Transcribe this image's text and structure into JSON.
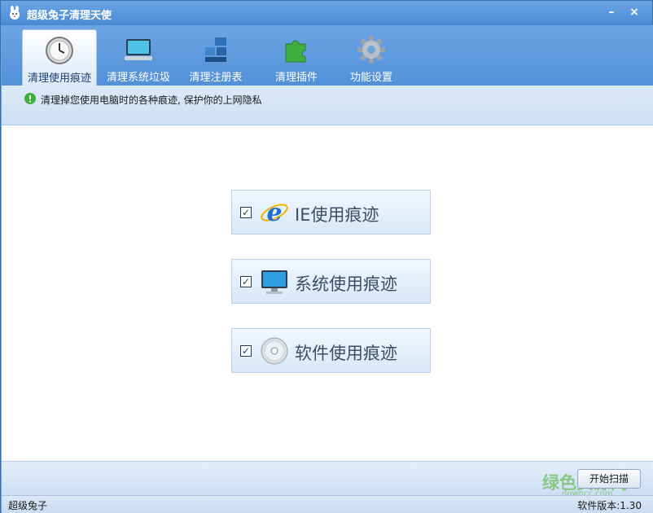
{
  "window": {
    "title": "超级兔子清理天使",
    "minimize_symbol": "–",
    "close_symbol": "×"
  },
  "toolbar": {
    "tabs": [
      {
        "label": "清理使用痕迹",
        "icon": "clock-icon",
        "active": true
      },
      {
        "label": "清理系统垃圾",
        "icon": "laptop-icon",
        "active": false
      },
      {
        "label": "清理注册表",
        "icon": "registry-blocks-icon",
        "active": false
      },
      {
        "label": "清理插件",
        "icon": "puzzle-icon",
        "active": false
      },
      {
        "label": "功能设置",
        "icon": "gear-icon",
        "active": false
      }
    ]
  },
  "info": {
    "text": "清理掉您使用电脑时的各种痕迹, 保护你的上网隐私",
    "icon": "info-icon"
  },
  "options": [
    {
      "label": "IE使用痕迹",
      "checked": true,
      "check_mark": "✓",
      "icon": "ie-icon"
    },
    {
      "label": "系统使用痕迹",
      "checked": true,
      "check_mark": "✓",
      "icon": "monitor-icon"
    },
    {
      "label": "软件使用痕迹",
      "checked": true,
      "check_mark": "✓",
      "icon": "cd-icon"
    }
  ],
  "bottom": {
    "scan_label": "开始扫描",
    "watermark": "绿色资源网",
    "watermark_sub": "downcc.com"
  },
  "status": {
    "left": "超级兔子",
    "right": "软件版本:1.30"
  },
  "colors": {
    "titlebar": "#4b89d3",
    "toolbar": "#5290d8",
    "accent_green": "#3fae3f"
  }
}
